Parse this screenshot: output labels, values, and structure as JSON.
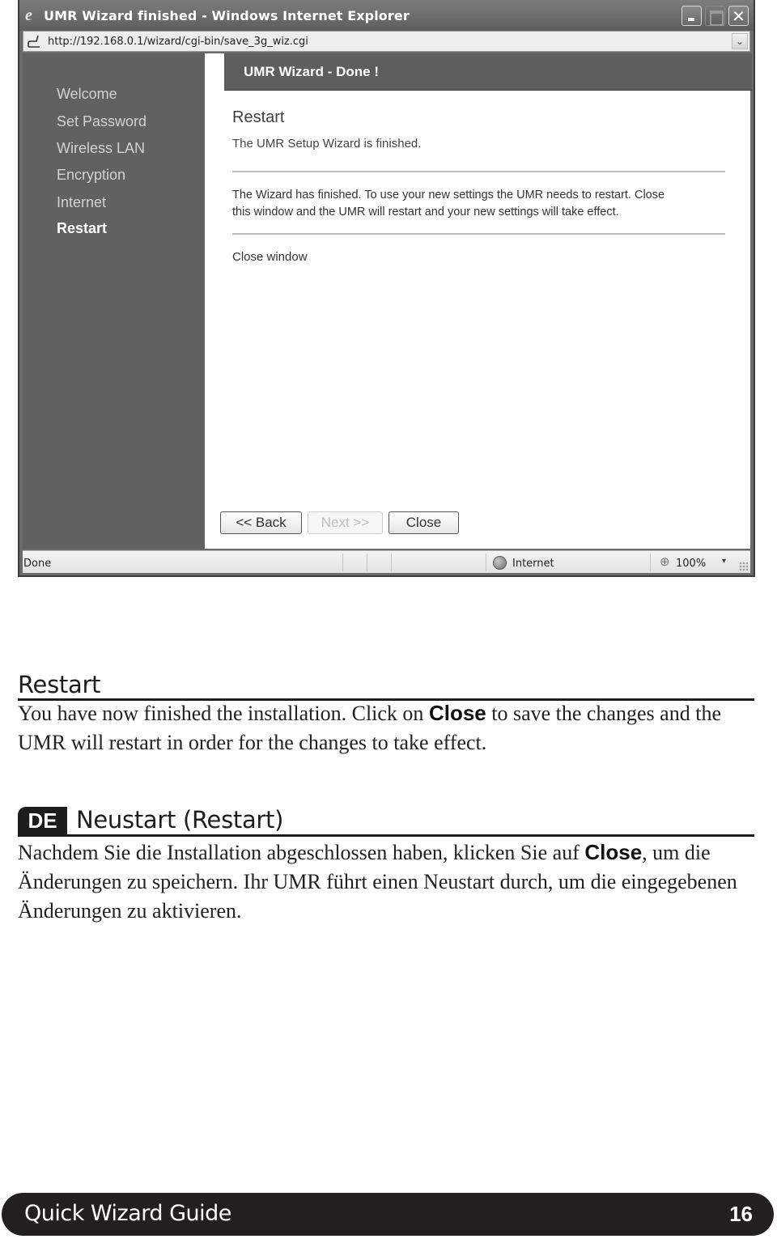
{
  "browser": {
    "title": "UMR Wizard finished - Windows Internet Explorer",
    "url": "http://192.168.0.1/wizard/cgi-bin/save_3g_wiz.cgi",
    "window_controls": {
      "minimize": "minimize",
      "maximize": "maximize",
      "close": "✕"
    },
    "address_dropdown_glyph": "⌄",
    "status": {
      "text": "Done",
      "zone": "Internet",
      "zoom": "100%",
      "zoom_arrow": "▾"
    }
  },
  "wizard": {
    "sidebar": {
      "items": [
        {
          "label": "Welcome",
          "active": false
        },
        {
          "label": "Set Password",
          "active": false
        },
        {
          "label": "Wireless LAN",
          "active": false
        },
        {
          "label": "Encryption",
          "active": false
        },
        {
          "label": "Internet",
          "active": false
        },
        {
          "label": "Restart",
          "active": true
        }
      ]
    },
    "header": "UMR Wizard - Done !",
    "section_title": "Restart",
    "subtitle": "The UMR Setup Wizard is finished.",
    "paragraph_line1": "The Wizard has finished. To use your new settings the UMR needs to restart. Close",
    "paragraph_line2": "this window and the UMR will restart and your new settings will take effect.",
    "close_link": "Close window",
    "buttons": {
      "back": "<< Back",
      "next": "Next >>",
      "close": "Close"
    }
  },
  "manual": {
    "en": {
      "heading": "Restart",
      "text_before": "You have now finished the installation. Click on ",
      "term": "Close",
      "text_after": " to save the changes and the UMR will restart in order for the changes to take effect."
    },
    "de": {
      "badge": "DE",
      "heading": "Neustart (Restart)",
      "text_before": "Nachdem Sie die Installation abgeschlossen haben, klicken Sie auf ",
      "term": "Close",
      "text_after": ", um die Änderungen zu speichern. Ihr UMR führt einen Neustart durch, um die eingegebenen Änderungen zu aktivieren."
    }
  },
  "footer": {
    "title": "Quick Wizard Guide",
    "page": "16"
  }
}
